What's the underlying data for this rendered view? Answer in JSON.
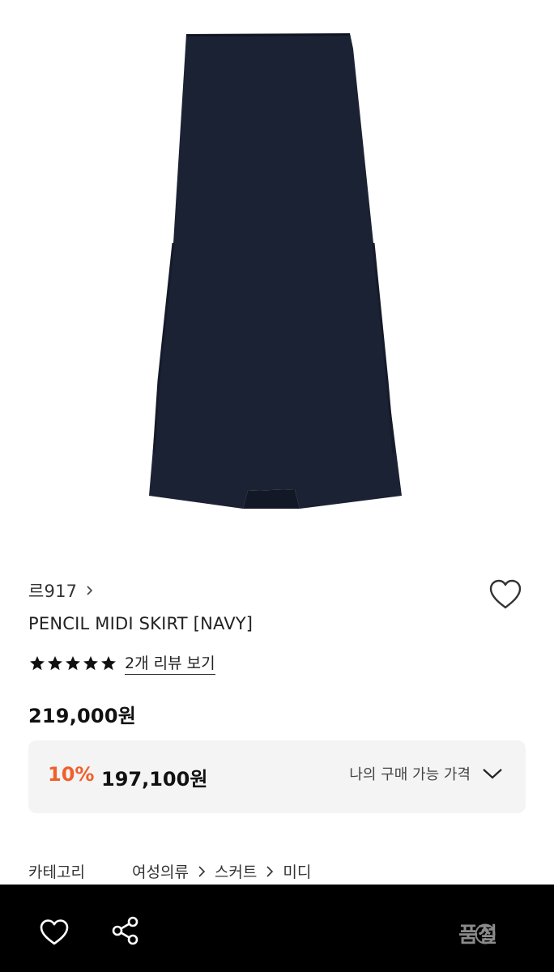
{
  "product": {
    "brand": "르917",
    "title": "PENCIL MIDI SKIRT [NAVY]",
    "rating_stars": 5,
    "review_link": "2개 리뷰 보기",
    "price": "219,000원",
    "discount_rate": "10%",
    "discount_price": "197,100원",
    "purchase_price_label": "나의 구매 가능 가격"
  },
  "category": {
    "label": "카테고리",
    "path": [
      "여성의류",
      "스커트",
      "미디"
    ]
  },
  "bottom_bar": {
    "soldout_label": "품절"
  },
  "colors": {
    "skirt": "#1b2233",
    "discount_accent": "#f0602b",
    "bottom_bar_bg": "#000000",
    "soldout_text": "#8a8a8a"
  },
  "icons": [
    "heart-icon",
    "chevron-right-icon",
    "star-icon",
    "chevron-down-icon",
    "share-icon",
    "help-icon"
  ]
}
